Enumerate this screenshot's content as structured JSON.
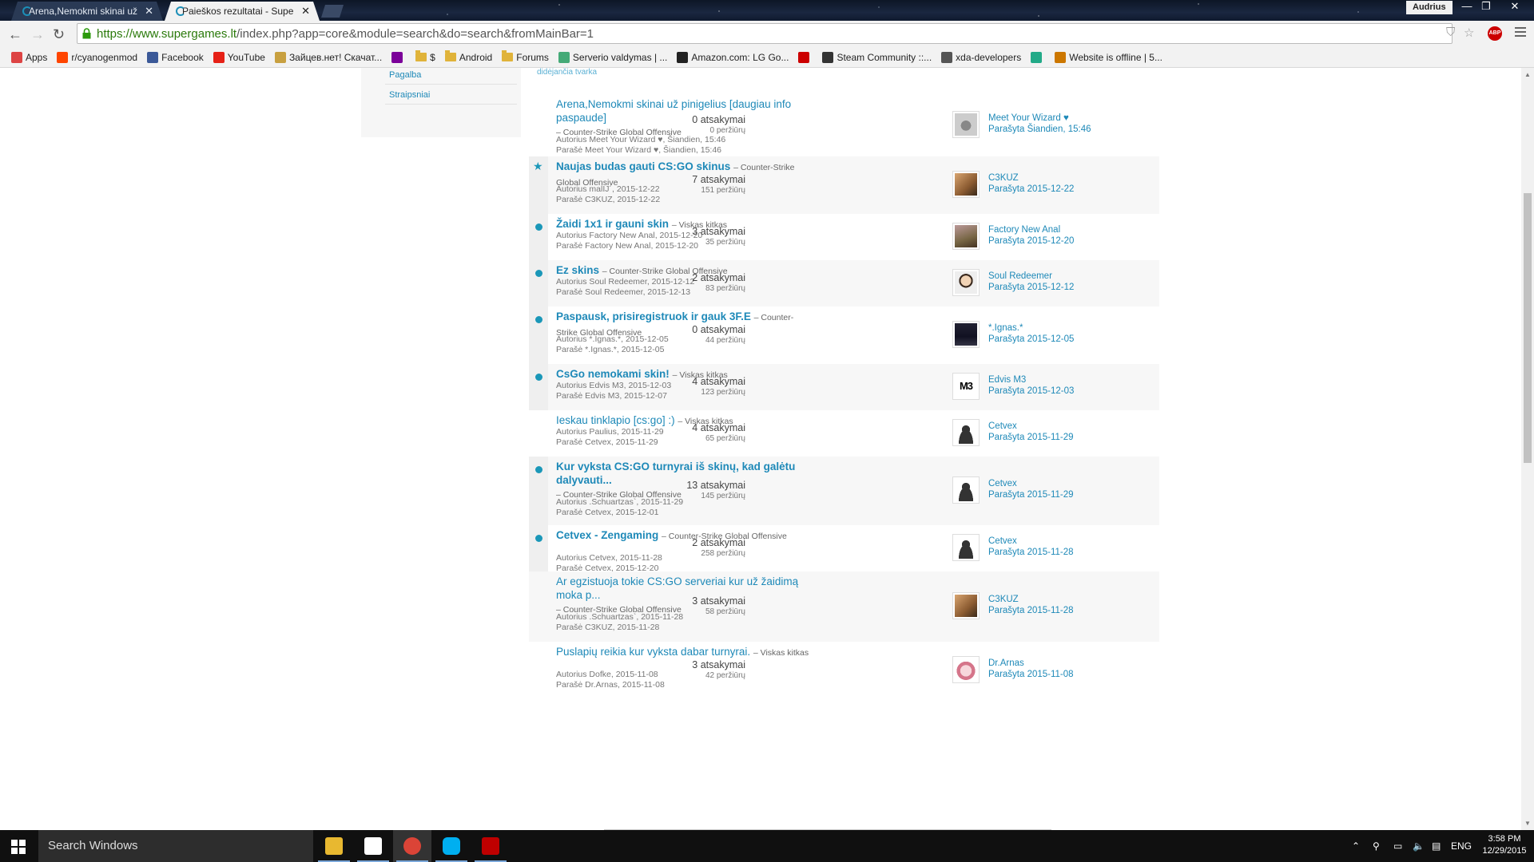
{
  "window": {
    "tabs": [
      {
        "label": "Arena,Nemokmi skinai už",
        "active": false
      },
      {
        "label": "Paieškos rezultatai - Super",
        "active": true
      }
    ],
    "user": "Audrius",
    "controls": {
      "minimize": "—",
      "restore": "❐",
      "close": "✕"
    }
  },
  "toolbar": {
    "url_host": "https://www.supergames.lt",
    "url_path": "/index.php?app=core&module=search&do=search&fromMainBar=1",
    "abp_label": "ABP"
  },
  "bookmarks": [
    {
      "label": "Apps",
      "icon": "apps-grid-icon",
      "color": "#d44"
    },
    {
      "label": "r/cyanogenmod",
      "icon": "reddit-icon",
      "color": "#ff4500"
    },
    {
      "label": "Facebook",
      "icon": "facebook-icon",
      "color": "#3b5998"
    },
    {
      "label": "YouTube",
      "icon": "youtube-icon",
      "color": "#e62117"
    },
    {
      "label": "Зайцев.нет! Скачат...",
      "icon": "zaycev-icon",
      "color": "#c8a040"
    },
    {
      "label": "",
      "icon": "yahoo-icon",
      "color": "#7b0099"
    },
    {
      "label": "$",
      "icon": "folder-icon",
      "color": "#e0b33a"
    },
    {
      "label": "Android",
      "icon": "folder-icon",
      "color": "#e0b33a"
    },
    {
      "label": "Forums",
      "icon": "folder-icon",
      "color": "#e0b33a"
    },
    {
      "label": "Serverio valdymas | ...",
      "icon": "server-icon",
      "color": "#4a7"
    },
    {
      "label": "Amazon.com: LG Go...",
      "icon": "amazon-icon",
      "color": "#222"
    },
    {
      "label": "",
      "icon": "flag-icon",
      "color": "#c00"
    },
    {
      "label": "Steam Community ::...",
      "icon": "steam-icon",
      "color": "#333"
    },
    {
      "label": "xda-developers",
      "icon": "xda-icon",
      "color": "#555"
    },
    {
      "label": "",
      "icon": "globe-icon",
      "color": "#2a8"
    },
    {
      "label": "Website is offline | 5...",
      "icon": "website-icon",
      "color": "#c70"
    }
  ],
  "sidebar": {
    "items": [
      {
        "label": "Pagalba"
      },
      {
        "label": "Straipsniai"
      }
    ],
    "sort_label": "didėjančia tvarka"
  },
  "results": [
    {
      "title": "Arena,Nemokmi skinai už pinigelius [daugiau info paspaude]",
      "forum": "– Counter-Strike Global Offensive",
      "forum_on_new_line": true,
      "bold": false,
      "marker": "none",
      "author": "Autorius Meet Your Wizard ♥, Šiandien, 15:46",
      "last": "Parašė Meet Your Wizard ♥, Šiandien, 15:46",
      "replies": "0 atsakymai",
      "views": "0 peržiūrų",
      "last_user": "Meet Your Wizard ♥",
      "last_date": "Parašyta Šiandien, 15:46",
      "avatar": "wizard"
    },
    {
      "title": "Naujas budas gauti CS:GO skinus",
      "forum": "– Counter-Strike Global Offensive",
      "forum_on_new_line": false,
      "bold": true,
      "marker": "star",
      "author": "Autorius malIJ´, 2015-12-22",
      "last": "Parašė C3KUZ, 2015-12-22",
      "replies": "7 atsakymai",
      "views": "151 peržiūrų",
      "last_user": "C3KUZ",
      "last_date": "Parašyta 2015-12-22",
      "avatar": "photo1"
    },
    {
      "title": "Žaidi 1x1 ir gauni skin",
      "forum": "– Viskas kitkas",
      "forum_on_new_line": false,
      "bold": true,
      "marker": "dot",
      "author": "Autorius Factory New Anal, 2015-12-20",
      "last": "Parašė Factory New Anal, 2015-12-20",
      "replies": "3 atsakymai",
      "views": "35 peržiūrų",
      "last_user": "Factory New Anal",
      "last_date": "Parašyta 2015-12-20",
      "avatar": "photo2"
    },
    {
      "title": "Ez skins",
      "forum": "– Counter-Strike Global Offensive",
      "forum_on_new_line": false,
      "bold": true,
      "marker": "dot",
      "author": "Autorius Soul Redeemer, 2015-12-12",
      "last": "Parašė Soul Redeemer, 2015-12-13",
      "replies": "2 atsakymai",
      "views": "83 peržiūrų",
      "last_user": "Soul Redeemer",
      "last_date": "Parašyta 2015-12-12",
      "avatar": "face"
    },
    {
      "title": "Paspausk, prisiregistruok ir gauk 3F.E",
      "forum": "– Counter-Strike Global Offensive",
      "forum_on_new_line": false,
      "bold": true,
      "marker": "dot",
      "author": "Autorius *.Ignas.*, 2015-12-05",
      "last": "Parašė *.Ignas.*, 2015-12-05",
      "replies": "0 atsakymai",
      "views": "44 peržiūrų",
      "last_user": "*.Ignas.*",
      "last_date": "Parašyta 2015-12-05",
      "avatar": "dark"
    },
    {
      "title": "CsGo nemokami skin!",
      "forum": "– Viskas kitkas",
      "forum_on_new_line": false,
      "bold": true,
      "marker": "dot",
      "author": "Autorius Edvis M3, 2015-12-03",
      "last": "Parašė Edvis M3, 2015-12-07",
      "replies": "4 atsakymai",
      "views": "123 peržiūrų",
      "last_user": "Edvis M3",
      "last_date": "Parašyta 2015-12-03",
      "avatar": "m3",
      "avatar_text": "M3"
    },
    {
      "title": "Ieskau tinklapio [cs:go] :)",
      "forum": "– Viskas kitkas",
      "forum_on_new_line": false,
      "bold": false,
      "marker": "none",
      "author": "Autorius Paulius, 2015-11-29",
      "last": "Parašė Cetvex, 2015-11-29",
      "replies": "4 atsakymai",
      "views": "65 peržiūrų",
      "last_user": "Cetvex",
      "last_date": "Parašyta 2015-11-29",
      "avatar": "default"
    },
    {
      "title": "Kur vyksta CS:GO turnyrai iš skinų, kad galėtu dalyvauti...",
      "forum": "– Counter-Strike Global Offensive",
      "forum_on_new_line": true,
      "bold": true,
      "marker": "dot",
      "author": "Autorius .Schuartzas`, 2015-11-29",
      "last": "Parašė Cetvex, 2015-12-01",
      "replies": "13 atsakymai",
      "views": "145 peržiūrų",
      "last_user": "Cetvex",
      "last_date": "Parašyta 2015-11-29",
      "avatar": "default"
    },
    {
      "title": "Cetvex - Zengaming",
      "forum": "– Counter-Strike Global Offensive",
      "forum_on_new_line": false,
      "bold": true,
      "marker": "dot",
      "author": "Autorius Cetvex, 2015-11-28",
      "last": "Parašė Cetvex, 2015-12-20",
      "replies": "2 atsakymai",
      "views": "258 peržiūrų",
      "last_user": "Cetvex",
      "last_date": "Parašyta 2015-11-28",
      "avatar": "default"
    },
    {
      "title": "Ar egzistuoja tokie CS:GO serveriai kur už žaidimą moka p...",
      "forum": "– Counter-Strike Global Offensive",
      "forum_on_new_line": true,
      "bold": false,
      "marker": "none",
      "author": "Autorius .Schuartzas`, 2015-11-28",
      "last": "Parašė C3KUZ, 2015-11-28",
      "replies": "3 atsakymai",
      "views": "58 peržiūrų",
      "last_user": "C3KUZ",
      "last_date": "Parašyta 2015-11-28",
      "avatar": "photo1"
    },
    {
      "title": "Puslapių reikia kur vyksta dabar turnyrai.",
      "forum": "– Viskas kitkas",
      "forum_on_new_line": false,
      "bold": false,
      "marker": "none",
      "author": "Autorius Dofke, 2015-11-08",
      "last": "Parašė Dr.Arnas, 2015-11-08",
      "replies": "3 atsakymai",
      "views": "42 peržiūrų",
      "last_user": "Dr.Arnas",
      "last_date": "Parašyta 2015-11-08",
      "avatar": "anime"
    }
  ],
  "taskbar": {
    "search_placeholder": "Search Windows",
    "apps": [
      {
        "name": "file-explorer",
        "color": "#e8b830",
        "active": false
      },
      {
        "name": "store",
        "color": "#ffffff",
        "active": false
      },
      {
        "name": "chrome",
        "color": "#db4437",
        "active": true
      },
      {
        "name": "skype",
        "color": "#00aff0",
        "active": false
      },
      {
        "name": "filezilla",
        "color": "#bf0000",
        "active": false
      }
    ],
    "language": "ENG",
    "time": "3:58 PM",
    "date": "12/29/2015"
  }
}
